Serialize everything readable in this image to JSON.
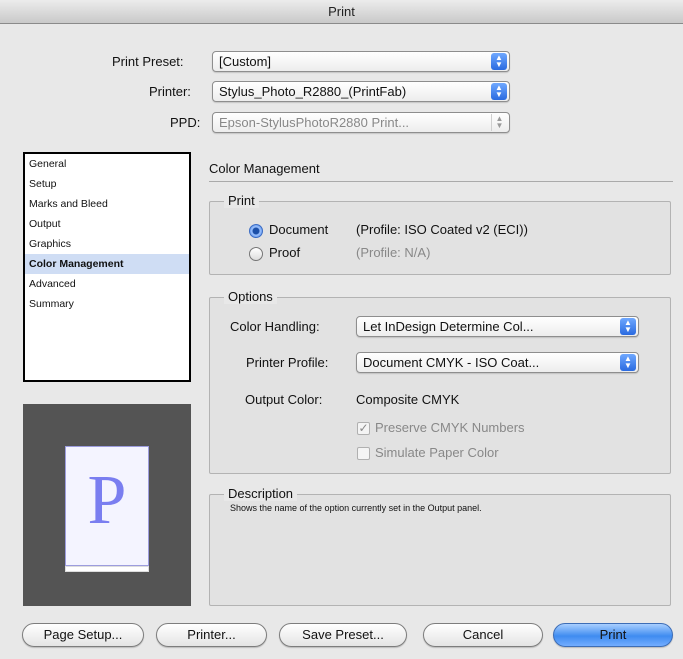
{
  "window": {
    "title": "Print"
  },
  "header": {
    "preset_label": "Print Preset:",
    "preset_value": "[Custom]",
    "printer_label": "Printer:",
    "printer_value": "Stylus_Photo_R2880_(PrintFab)",
    "ppd_label": "PPD:",
    "ppd_value": "Epson-StylusPhotoR2880 Print..."
  },
  "sidebar": {
    "items": [
      {
        "label": "General"
      },
      {
        "label": "Setup"
      },
      {
        "label": "Marks and Bleed"
      },
      {
        "label": "Output"
      },
      {
        "label": "Graphics"
      },
      {
        "label": "Color Management"
      },
      {
        "label": "Advanced"
      },
      {
        "label": "Summary"
      }
    ],
    "selected": "Color Management"
  },
  "preview": {
    "letter": "P"
  },
  "panel": {
    "title": "Color Management",
    "print_group": {
      "label": "Print",
      "document_label": "Document",
      "document_profile": "(Profile: ISO Coated v2 (ECI))",
      "proof_label": "Proof",
      "proof_profile": "(Profile: N/A)",
      "selected": "Document"
    },
    "options_group": {
      "label": "Options",
      "color_handling_label": "Color Handling:",
      "color_handling_value": "Let InDesign Determine Col...",
      "printer_profile_label": "Printer Profile:",
      "printer_profile_value": "Document CMYK - ISO Coat...",
      "output_color_label": "Output Color:",
      "output_color_value": "Composite CMYK",
      "preserve_cmyk_label": "Preserve CMYK Numbers",
      "preserve_cmyk_checked": true,
      "simulate_paper_label": "Simulate Paper Color",
      "simulate_paper_checked": false
    },
    "description_group": {
      "label": "Description",
      "text": "Shows the name of the option currently set in the Output panel."
    }
  },
  "buttons": {
    "page_setup": "Page Setup...",
    "printer": "Printer...",
    "save_preset": "Save Preset...",
    "cancel": "Cancel",
    "print": "Print"
  },
  "colors": {
    "accent": "#3f8cf0",
    "selection": "#cfddf4"
  }
}
